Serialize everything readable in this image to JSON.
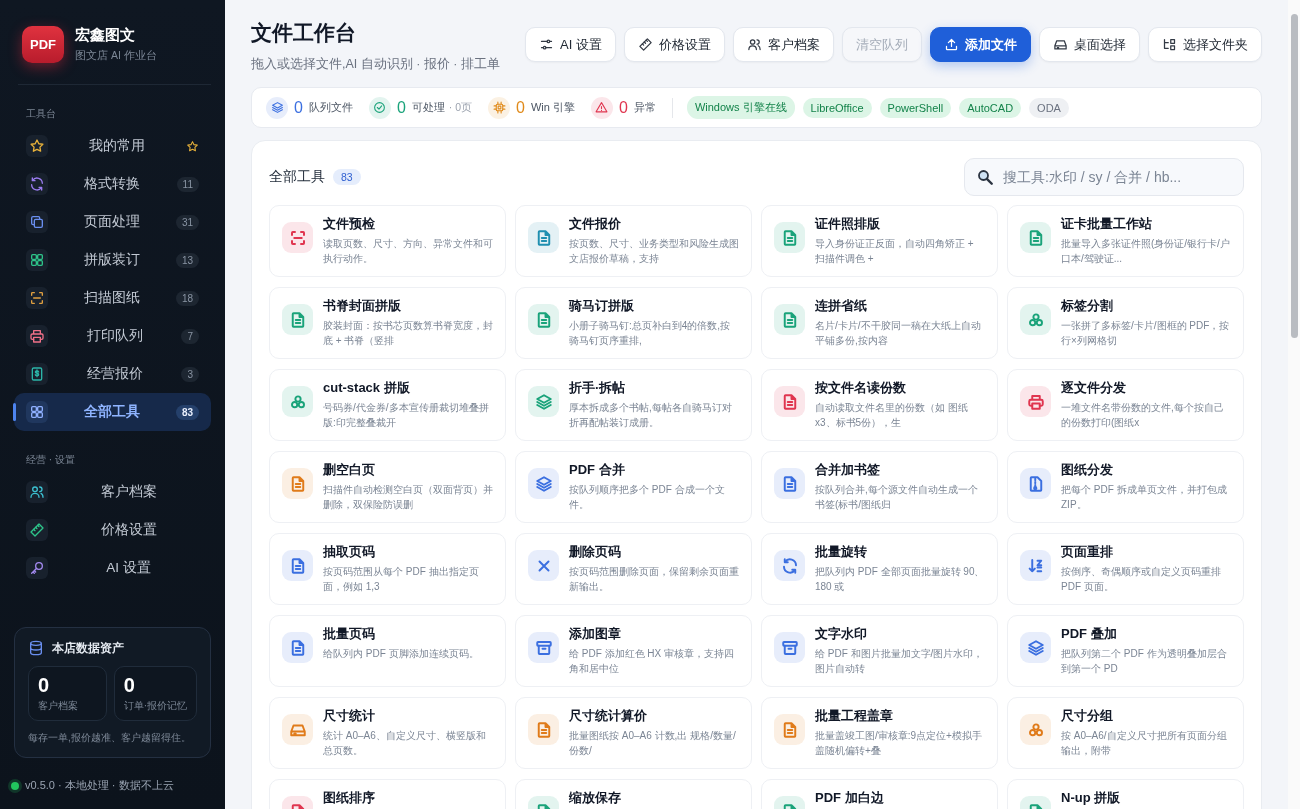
{
  "brand": {
    "logo": "PDF",
    "name": "宏鑫图文",
    "subtitle": "图文店 AI 作业台"
  },
  "sidebar": {
    "sections": [
      {
        "title": "工具台",
        "items": [
          {
            "label": "我的常用",
            "kind": "star",
            "color": "#e7b13a",
            "pinned": true,
            "selected": false
          },
          {
            "label": "格式转换",
            "kind": "rotate",
            "color": "#9b7cf0",
            "count": "11",
            "selected": false
          },
          {
            "label": "页面处理",
            "kind": "copy",
            "color": "#6a8ff0",
            "count": "31",
            "selected": false
          },
          {
            "label": "拼版装订",
            "kind": "grid",
            "color": "#2ec48a",
            "count": "13",
            "selected": false
          },
          {
            "label": "扫描图纸",
            "kind": "scan",
            "color": "#e0a040",
            "count": "18",
            "selected": false
          },
          {
            "label": "打印队列",
            "kind": "print",
            "color": "#f07088",
            "count": "7",
            "selected": false
          },
          {
            "label": "经营报价",
            "kind": "dollar",
            "color": "#2bb5a8",
            "count": "3",
            "selected": false
          },
          {
            "label": "全部工具",
            "kind": "grid",
            "color": "#8fb0ff",
            "count": "83",
            "selected": true
          }
        ]
      },
      {
        "title": "经营 · 设置",
        "items": [
          {
            "label": "客户档案",
            "kind": "users",
            "color": "#3cc0d0",
            "selected": false
          },
          {
            "label": "价格设置",
            "kind": "ruler",
            "color": "#2ec48a",
            "selected": false
          },
          {
            "label": "AI 设置",
            "kind": "key",
            "color": "#a48af0",
            "selected": false
          }
        ]
      }
    ]
  },
  "assets": {
    "title": "本店数据资产",
    "stats": [
      {
        "value": "0",
        "label": "客户档案"
      },
      {
        "value": "0",
        "label": "订单·报价记忆"
      }
    ],
    "note": "每存一单,报价越准、客户越留得住。"
  },
  "footer": {
    "online": true,
    "text": "v0.5.0 · 本地处理 · 数据不上云"
  },
  "header": {
    "title": "文件工作台",
    "subtitle": "拖入或选择文件,AI 自动识别 · 报价 · 排工单"
  },
  "toolbar": [
    {
      "label": "AI 设置",
      "kind": "sliders",
      "primary": false,
      "disabled": false
    },
    {
      "label": "价格设置",
      "kind": "ruler",
      "primary": false,
      "disabled": false
    },
    {
      "label": "客户档案",
      "kind": "users",
      "primary": false,
      "disabled": false
    },
    {
      "label": "清空队列",
      "kind": "none",
      "primary": false,
      "disabled": true
    },
    {
      "label": "添加文件",
      "kind": "upload",
      "primary": true,
      "disabled": false
    },
    {
      "label": "桌面选择",
      "kind": "drive",
      "primary": false,
      "disabled": false
    },
    {
      "label": "选择文件夹",
      "kind": "folder",
      "primary": false,
      "disabled": false
    }
  ],
  "stats": [
    {
      "kind": "layers",
      "color": "#3b6fe0",
      "value": "0",
      "label": "队列文件"
    },
    {
      "kind": "check",
      "color": "#1aa37a",
      "value": "0",
      "label": "可处理",
      "extra": "· 0页"
    },
    {
      "kind": "chip",
      "color": "#e08a1a",
      "value": "0",
      "label": "Win 引擎"
    },
    {
      "kind": "alert",
      "color": "#e0354f",
      "value": "0",
      "label": "异常"
    }
  ],
  "engines": [
    {
      "label": "Windows 引擎在线",
      "on": true
    },
    {
      "label": "LibreOffice",
      "on": true
    },
    {
      "label": "PowerShell",
      "on": true
    },
    {
      "label": "AutoCAD",
      "on": true
    },
    {
      "label": "ODA",
      "on": false
    }
  ],
  "tools_panel": {
    "title": "全部工具",
    "count": "83",
    "search": {
      "placeholder": "搜工具:水印 / sy / 合并 / hb..."
    },
    "tools": [
      {
        "title": "文件预检",
        "desc": "读取页数、尺寸、方向、异常文件和可执行动作。",
        "kind": "scan",
        "color": "#e0354f"
      },
      {
        "title": "文件报价",
        "desc": "按页数、尺寸、业务类型和风险生成图文店报价草稿，支持",
        "kind": "doc",
        "color": "#1f8fb0"
      },
      {
        "title": "证件照排版",
        "desc": "导入身份证正反面，自动四角矫正 + 扫描件调色 +",
        "kind": "doc",
        "color": "#1aa37a"
      },
      {
        "title": "证卡批量工作站",
        "desc": "批量导入多张证件照(身份证/银行卡/户口本/驾驶证...",
        "kind": "doc",
        "color": "#1aa37a"
      },
      {
        "title": "书脊封面拼版",
        "desc": "胶装封面：按书芯页数算书脊宽度，封底 + 书脊（竖排",
        "kind": "doc",
        "color": "#1aa37a"
      },
      {
        "title": "骑马订拼版",
        "desc": "小册子骑马钉:总页补白到4的倍数,按骑马钉页序重排,",
        "kind": "doc",
        "color": "#1aa37a"
      },
      {
        "title": "连拼省纸",
        "desc": "名片/卡片/不干胶同一稿在大纸上自动平铺多份,按内容",
        "kind": "doc",
        "color": "#1aa37a"
      },
      {
        "title": "标签分割",
        "desc": "一张拼了多标签/卡片/图框的 PDF，按行×列网格切",
        "kind": "clover",
        "color": "#1aa37a"
      },
      {
        "title": "cut-stack 拼版",
        "desc": "号码券/代金券/多本宣传册裁切堆叠拼版:印完整叠裁开",
        "kind": "clover",
        "color": "#1aa37a"
      },
      {
        "title": "折手·拆帖",
        "desc": "厚本拆成多个书帖,每帖各自骑马订对折再配帖装订成册。",
        "kind": "layers",
        "color": "#1aa37a"
      },
      {
        "title": "按文件名读份数",
        "desc": "自动读取文件名里的份数（如 图纸x3、标书5份），生",
        "kind": "doc",
        "color": "#e0354f"
      },
      {
        "title": "逐文件分发",
        "desc": "一堆文件名带份数的文件,每个按自己的份数打印(图纸x",
        "kind": "print",
        "color": "#e0354f"
      },
      {
        "title": "删空白页",
        "desc": "扫描件自动检测空白页（双面背页）并删除，双保险防误删",
        "kind": "doc",
        "color": "#e07b1a"
      },
      {
        "title": "PDF 合并",
        "desc": "按队列顺序把多个 PDF 合成一个文件。",
        "kind": "layers",
        "color": "#3b6fe0"
      },
      {
        "title": "合并加书签",
        "desc": "按队列合并,每个源文件自动生成一个书签(标书/图纸归",
        "kind": "doc",
        "color": "#3b6fe0"
      },
      {
        "title": "图纸分发",
        "desc": "把每个 PDF 拆成单页文件，并打包成 ZIP。",
        "kind": "zip",
        "color": "#3b6fe0"
      },
      {
        "title": "抽取页码",
        "desc": "按页码范围从每个 PDF 抽出指定页面，例如 1,3",
        "kind": "doc",
        "color": "#3b6fe0"
      },
      {
        "title": "删除页码",
        "desc": "按页码范围删除页面，保留剩余页面重新输出。",
        "kind": "x",
        "color": "#3b6fe0"
      },
      {
        "title": "批量旋转",
        "desc": "把队列内 PDF 全部页面批量旋转 90、180 或",
        "kind": "rotate",
        "color": "#3b6fe0"
      },
      {
        "title": "页面重排",
        "desc": "按倒序、奇偶顺序或自定义页码重排 PDF 页面。",
        "kind": "sort",
        "color": "#3b6fe0"
      },
      {
        "title": "批量页码",
        "desc": "给队列内 PDF 页脚添加连续页码。",
        "kind": "doc",
        "color": "#3b6fe0"
      },
      {
        "title": "添加图章",
        "desc": "给 PDF 添加红色 HX 审核章，支持四角和居中位",
        "kind": "stamp",
        "color": "#3b6fe0"
      },
      {
        "title": "文字水印",
        "desc": "给 PDF 和图片批量加文字/图片水印，图片自动转",
        "kind": "stamp",
        "color": "#3b6fe0"
      },
      {
        "title": "PDF 叠加",
        "desc": "把队列第二个 PDF 作为透明叠加层合到第一个 PD",
        "kind": "layers",
        "color": "#3b6fe0"
      },
      {
        "title": "尺寸统计",
        "desc": "统计 A0–A6、自定义尺寸、横竖版和总页数。",
        "kind": "drive",
        "color": "#e07b1a"
      },
      {
        "title": "尺寸统计算价",
        "desc": "批量图纸按 A0–A6 计数,出 规格/数量/份数/",
        "kind": "doc",
        "color": "#e07b1a"
      },
      {
        "title": "批量工程盖章",
        "desc": "批量盖竣工图/审核章:9点定位+模拟手盖随机偏转+叠",
        "kind": "doc",
        "color": "#e07b1a"
      },
      {
        "title": "尺寸分组",
        "desc": "按 A0–A6/自定义尺寸把所有页面分组输出，附带",
        "kind": "clover",
        "color": "#e07b1a"
      },
      {
        "title": "图纸排序",
        "kind": "doc",
        "color": "#e0354f"
      },
      {
        "title": "缩放保存",
        "kind": "doc",
        "color": "#1aa37a"
      },
      {
        "title": "PDF 加白边",
        "kind": "doc",
        "color": "#1aa37a"
      },
      {
        "title": "N-up 拼版",
        "kind": "doc",
        "color": "#1aa37a"
      }
    ]
  }
}
